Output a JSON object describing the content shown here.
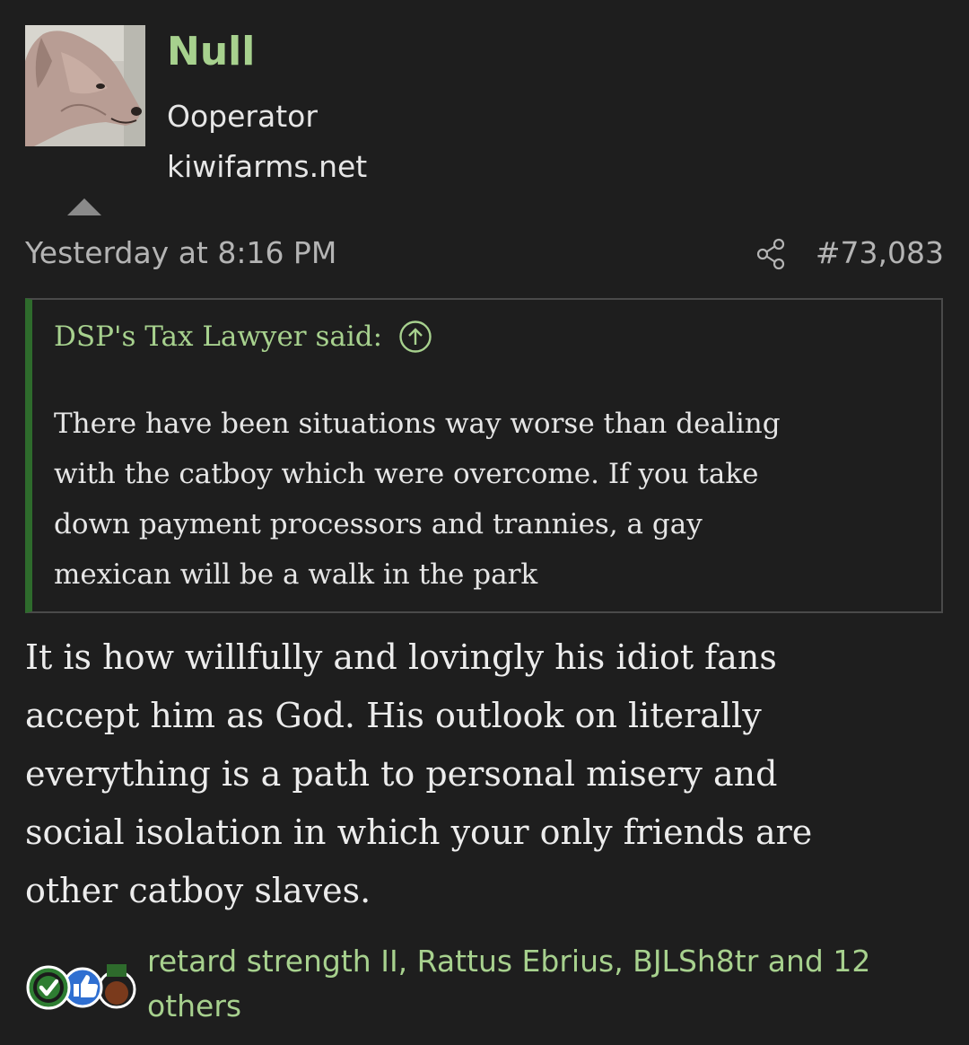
{
  "post": {
    "author": {
      "name": "Null",
      "title": "Ooperator",
      "site": "kiwifarms.net",
      "avatar_icon": "dog-avatar"
    },
    "date": "Yesterday at 8:16 PM",
    "number": "#73,083",
    "share_icon": "share-icon",
    "quote": {
      "author_line": "DSP's Tax Lawyer said:",
      "jump_icon": "arrow-up-circle-icon",
      "lines": [
        "There have been situations way worse than dealing",
        "with the catboy which were overcome. If you take",
        "down payment processors and trannies, a gay",
        "mexican will be a walk in the park"
      ]
    },
    "body_lines": [
      "It is how willfully and lovingly his idiot fans",
      "accept him as God. His outlook on literally",
      "everything is a path to personal misery and",
      "social isolation in which your only friends are",
      "other catboy slaves."
    ],
    "reactions": {
      "icons": [
        "check-icon",
        "thumbs-up-icon",
        "winner-icon"
      ],
      "text_line_1": "retard strength II, Rattus Ebrius, BJLSh8tr and 12",
      "text_line_2": "others"
    }
  },
  "colors": {
    "background": "#1e1e1e",
    "accent_green": "#a7d18e",
    "quote_border": "#2e6b2c",
    "muted": "#b4b4b4"
  }
}
